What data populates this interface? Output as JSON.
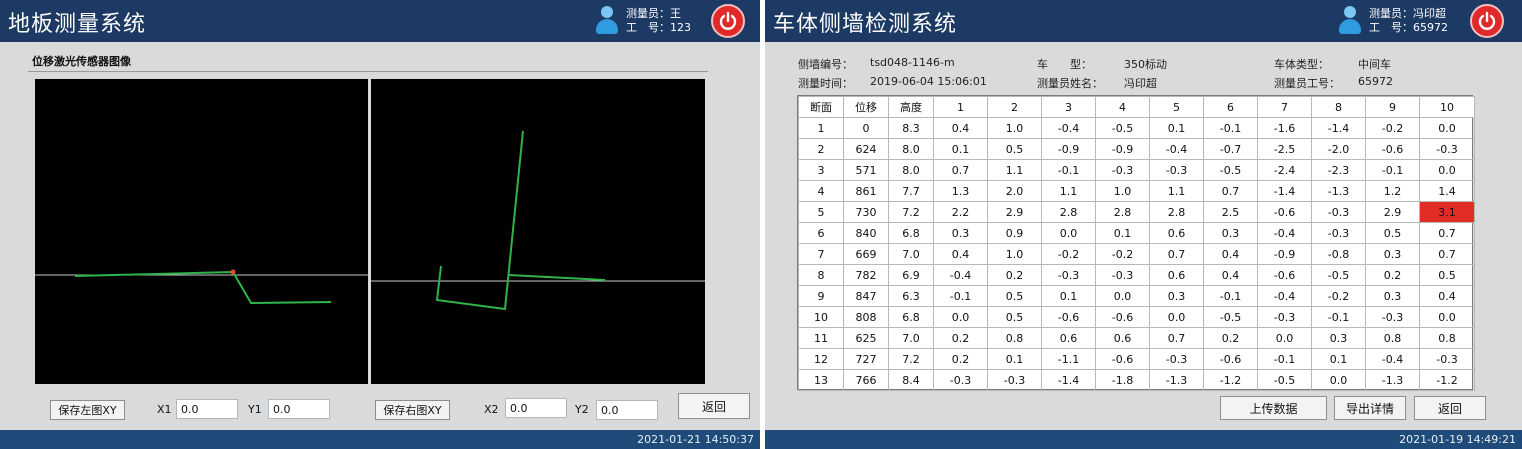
{
  "left": {
    "title": "地板测量系统",
    "user_line1": "测量员：王",
    "user_line2": "工　号：123",
    "section_title": "位移激光传感器图像",
    "save_left_label": "保存左图XY",
    "x1_label": "X1",
    "x1_value": "0.0",
    "y1_label": "Y1",
    "y1_value": "0.0",
    "save_right_label": "保存右图XY",
    "x2_label": "X2",
    "x2_value": "0.0",
    "y2_label": "Y2",
    "y2_value": "0.0",
    "back_label": "返回",
    "status_time": "2021-01-21 14:50:37"
  },
  "right": {
    "title": "车体侧墙检测系统",
    "user_line1": "测量员：冯印超",
    "user_line2": "工　号：65972",
    "info": {
      "wall_no_label": "侧墙编号：",
      "wall_no": "tsd048-1146-m",
      "car_type_label": "车　　型：",
      "car_type": "350标动",
      "body_type_label": "车体类型：",
      "body_type": "中间车",
      "time_label": "测量时间：",
      "time": "2019-06-04 15:06:01",
      "operator_label": "测量员姓名：",
      "operator": "冯印超",
      "operator_id_label": "测量员工号：",
      "operator_id": "65972"
    },
    "table": {
      "headers": [
        "断面",
        "位移",
        "高度",
        "1",
        "2",
        "3",
        "4",
        "5",
        "6",
        "7",
        "8",
        "9",
        "10"
      ],
      "rows": [
        [
          "1",
          "0",
          "8.3",
          "0.4",
          "1.0",
          "-0.4",
          "-0.5",
          "0.1",
          "-0.1",
          "-1.6",
          "-1.4",
          "-0.2",
          "0.0"
        ],
        [
          "2",
          "624",
          "8.0",
          "0.1",
          "0.5",
          "-0.9",
          "-0.9",
          "-0.4",
          "-0.7",
          "-2.5",
          "-2.0",
          "-0.6",
          "-0.3"
        ],
        [
          "3",
          "571",
          "8.0",
          "0.7",
          "1.1",
          "-0.1",
          "-0.3",
          "-0.3",
          "-0.5",
          "-2.4",
          "-2.3",
          "-0.1",
          "0.0"
        ],
        [
          "4",
          "861",
          "7.7",
          "1.3",
          "2.0",
          "1.1",
          "1.0",
          "1.1",
          "0.7",
          "-1.4",
          "-1.3",
          "1.2",
          "1.4"
        ],
        [
          "5",
          "730",
          "7.2",
          "2.2",
          "2.9",
          "2.8",
          "2.8",
          "2.8",
          "2.5",
          "-0.6",
          "-0.3",
          "2.9",
          "3.1"
        ],
        [
          "6",
          "840",
          "6.8",
          "0.3",
          "0.9",
          "0.0",
          "0.1",
          "0.6",
          "0.3",
          "-0.4",
          "-0.3",
          "0.5",
          "0.7"
        ],
        [
          "7",
          "669",
          "7.0",
          "0.4",
          "1.0",
          "-0.2",
          "-0.2",
          "0.7",
          "0.4",
          "-0.9",
          "-0.8",
          "0.3",
          "0.7"
        ],
        [
          "8",
          "782",
          "6.9",
          "-0.4",
          "0.2",
          "-0.3",
          "-0.3",
          "0.6",
          "0.4",
          "-0.6",
          "-0.5",
          "0.2",
          "0.5"
        ],
        [
          "9",
          "847",
          "6.3",
          "-0.1",
          "0.5",
          "0.1",
          "0.0",
          "0.3",
          "-0.1",
          "-0.4",
          "-0.2",
          "0.3",
          "0.4"
        ],
        [
          "10",
          "808",
          "6.8",
          "0.0",
          "0.5",
          "-0.6",
          "-0.6",
          "0.0",
          "-0.5",
          "-0.3",
          "-0.1",
          "-0.3",
          "0.0"
        ],
        [
          "11",
          "625",
          "7.0",
          "0.2",
          "0.8",
          "0.6",
          "0.6",
          "0.7",
          "0.2",
          "0.0",
          "0.3",
          "0.8",
          "0.8"
        ],
        [
          "12",
          "727",
          "7.2",
          "0.2",
          "0.1",
          "-1.1",
          "-0.6",
          "-0.3",
          "-0.6",
          "-0.1",
          "0.1",
          "-0.4",
          "-0.3"
        ],
        [
          "13",
          "766",
          "8.4",
          "-0.3",
          "-0.3",
          "-1.4",
          "-1.8",
          "-1.3",
          "-1.2",
          "-0.5",
          "0.0",
          "-1.3",
          "-1.2"
        ]
      ],
      "highlight": {
        "row": 4,
        "col": 12,
        "color": "#e22d26"
      }
    },
    "upload_label": "上传数据",
    "export_label": "导出详情",
    "back_label": "返回",
    "status_time": "2021-01-19 14:49:21"
  },
  "colors": {
    "titlebar": "#1c3a63",
    "statusbar": "#1f4b7a",
    "panel_bg": "#d9dadb",
    "profile_line": "#2fb34a",
    "baseline": "#c8c8c8",
    "alarm": "#e22d26"
  },
  "icons": [
    "user-icon",
    "power-icon"
  ]
}
